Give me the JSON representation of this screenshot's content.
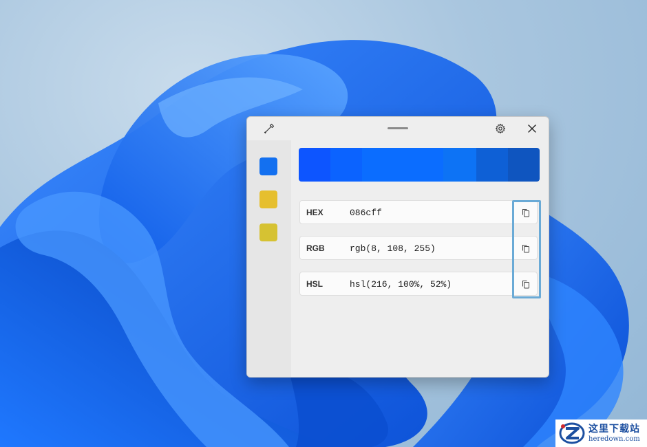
{
  "colors": {
    "selected": "#086cff",
    "history": [
      "#1370f0",
      "#e6bf2e",
      "#d6c232"
    ],
    "strip": [
      "#0d55ff",
      "#0b63ff",
      "#0b6dff",
      "#0d73f5",
      "#0e60d6",
      "#0f55bf"
    ],
    "highlight": "#6aaad6"
  },
  "window": {
    "picker_icon": "eyedropper-icon",
    "settings_icon": "gear-icon",
    "close_icon": "close-icon"
  },
  "formats": [
    {
      "label": "HEX",
      "value": "086cff",
      "copy_icon": "copy-icon"
    },
    {
      "label": "RGB",
      "value": "rgb(8, 108, 255)",
      "copy_icon": "copy-icon"
    },
    {
      "label": "HSL",
      "value": "hsl(216, 100%, 52%)",
      "copy_icon": "copy-icon"
    }
  ],
  "watermark": {
    "title": "这里下载站",
    "url": "heredown.com"
  }
}
